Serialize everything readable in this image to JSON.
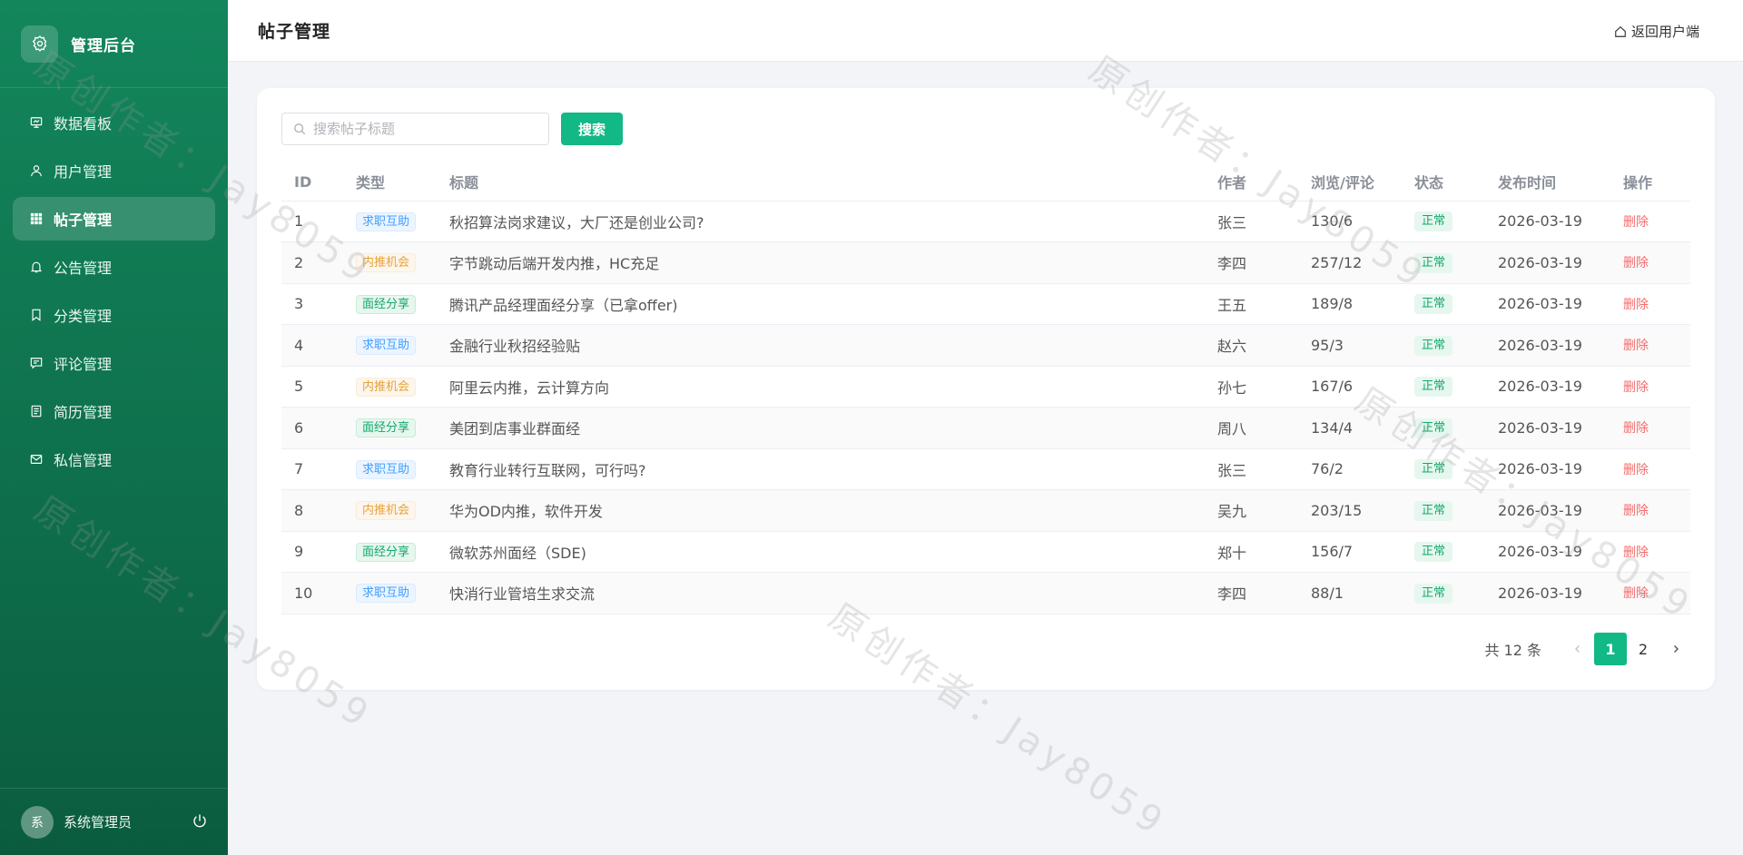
{
  "sidebar": {
    "brand": "管理后台",
    "items": [
      {
        "label": "数据看板",
        "icon": "dashboard-icon"
      },
      {
        "label": "用户管理",
        "icon": "user-icon"
      },
      {
        "label": "帖子管理",
        "icon": "grid-icon",
        "active": true
      },
      {
        "label": "公告管理",
        "icon": "bell-icon"
      },
      {
        "label": "分类管理",
        "icon": "bookmark-icon"
      },
      {
        "label": "评论管理",
        "icon": "comment-icon"
      },
      {
        "label": "简历管理",
        "icon": "document-icon"
      },
      {
        "label": "私信管理",
        "icon": "mail-icon"
      }
    ],
    "user": {
      "avatar_text": "系",
      "name": "系统管理员"
    }
  },
  "header": {
    "title": "帖子管理",
    "back_link": "返回用户端"
  },
  "search": {
    "placeholder": "搜索帖子标题",
    "button": "搜索"
  },
  "table": {
    "columns": [
      "ID",
      "类型",
      "标题",
      "作者",
      "浏览/评论",
      "状态",
      "发布时间",
      "操作"
    ],
    "rows": [
      {
        "id": "1",
        "type": "求职互助",
        "type_color": "blue",
        "title": "秋招算法岗求建议，大厂还是创业公司?",
        "author": "张三",
        "stats": "130/6",
        "status": "正常",
        "date": "2026-03-19",
        "action": "删除"
      },
      {
        "id": "2",
        "type": "内推机会",
        "type_color": "orange",
        "title": "字节跳动后端开发内推，HC充足",
        "author": "李四",
        "stats": "257/12",
        "status": "正常",
        "date": "2026-03-19",
        "action": "删除"
      },
      {
        "id": "3",
        "type": "面经分享",
        "type_color": "green",
        "title": "腾讯产品经理面经分享（已拿offer)",
        "author": "王五",
        "stats": "189/8",
        "status": "正常",
        "date": "2026-03-19",
        "action": "删除"
      },
      {
        "id": "4",
        "type": "求职互助",
        "type_color": "blue",
        "title": "金融行业秋招经验贴",
        "author": "赵六",
        "stats": "95/3",
        "status": "正常",
        "date": "2026-03-19",
        "action": "删除"
      },
      {
        "id": "5",
        "type": "内推机会",
        "type_color": "orange",
        "title": "阿里云内推，云计算方向",
        "author": "孙七",
        "stats": "167/6",
        "status": "正常",
        "date": "2026-03-19",
        "action": "删除"
      },
      {
        "id": "6",
        "type": "面经分享",
        "type_color": "green",
        "title": "美团到店事业群面经",
        "author": "周八",
        "stats": "134/4",
        "status": "正常",
        "date": "2026-03-19",
        "action": "删除"
      },
      {
        "id": "7",
        "type": "求职互助",
        "type_color": "blue",
        "title": "教育行业转行互联网，可行吗?",
        "author": "张三",
        "stats": "76/2",
        "status": "正常",
        "date": "2026-03-19",
        "action": "删除"
      },
      {
        "id": "8",
        "type": "内推机会",
        "type_color": "orange",
        "title": "华为OD内推，软件开发",
        "author": "吴九",
        "stats": "203/15",
        "status": "正常",
        "date": "2026-03-19",
        "action": "删除"
      },
      {
        "id": "9",
        "type": "面经分享",
        "type_color": "green",
        "title": "微软苏州面经（SDE)",
        "author": "郑十",
        "stats": "156/7",
        "status": "正常",
        "date": "2026-03-19",
        "action": "删除"
      },
      {
        "id": "10",
        "type": "求职互助",
        "type_color": "blue",
        "title": "快消行业管培生求交流",
        "author": "李四",
        "stats": "88/1",
        "status": "正常",
        "date": "2026-03-19",
        "action": "删除"
      }
    ]
  },
  "pagination": {
    "total": "共 12 条",
    "pages": [
      "1",
      "2"
    ],
    "current": "1"
  },
  "watermark": "原创作者：Jay8059",
  "colors": {
    "primary": "#12b886",
    "sidebar": "#0e6e4b",
    "danger": "#f56c6c"
  }
}
